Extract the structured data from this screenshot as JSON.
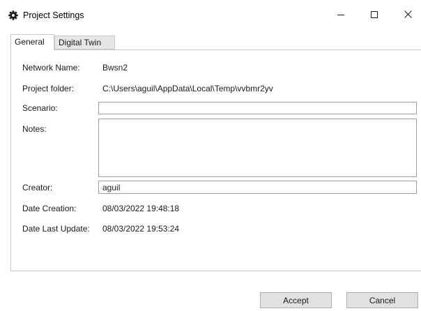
{
  "window": {
    "title": "Project Settings",
    "icon": "gear-icon",
    "controls": [
      "minimize-icon",
      "maximize-icon",
      "close-icon"
    ]
  },
  "tabs": [
    {
      "label": "General",
      "selected": true
    },
    {
      "label": "Digital Twin",
      "selected": false
    }
  ],
  "general": {
    "network_name_label": "Network Name:",
    "network_name_value": "Bwsn2",
    "project_folder_label": "Project folder:",
    "project_folder_value": "C:\\Users\\aguil\\AppData\\Local\\Temp\\vvbmr2yv",
    "scenario_label": "Scenario:",
    "scenario_value": "",
    "notes_label": "Notes:",
    "notes_value": "",
    "creator_label": "Creator:",
    "creator_value": "aguil",
    "date_creation_label": "Date Creation:",
    "date_creation_value": "08/03/2022 19:48:18",
    "date_last_update_label": "Date Last Update:",
    "date_last_update_value": "08/03/2022 19:53:24"
  },
  "buttons": {
    "accept_label": "Accept",
    "cancel_label": "Cancel"
  },
  "colors": {
    "tab_inactive_bg": "#e6e6e6",
    "button_bg": "#e1e1e1",
    "border": "#c8c8c8"
  }
}
